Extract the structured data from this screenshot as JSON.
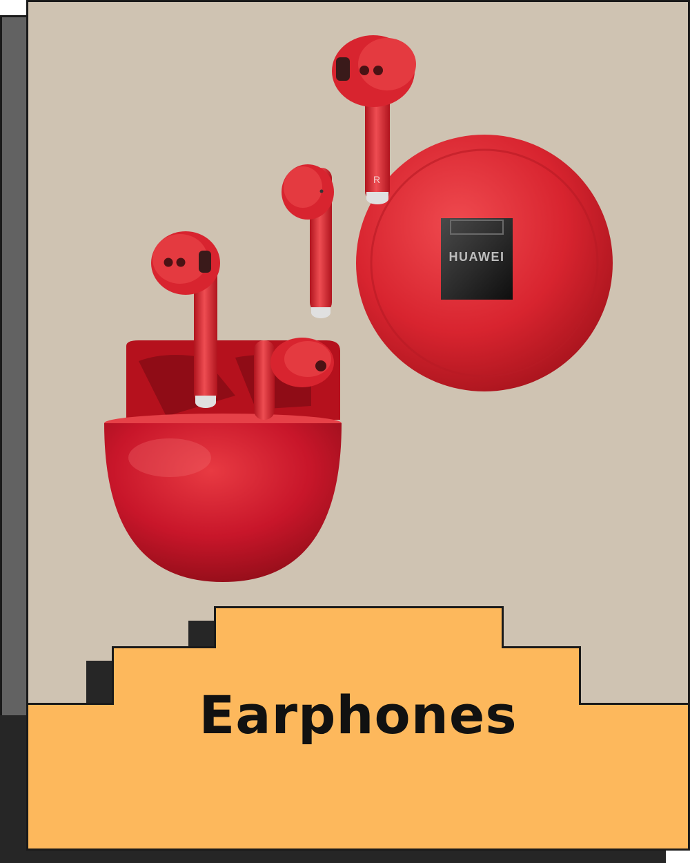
{
  "card": {
    "title": "Earphones",
    "product_brand": "HUAWEI",
    "earbud_side_mark": "R"
  },
  "colors": {
    "background_panel": "#cfc3b2",
    "accent_yellow": "#fdb85c",
    "product_red": "#d8242f",
    "border": "#1a1a1a"
  },
  "icons": {
    "product_image": "red-wireless-earbuds-with-charging-case"
  }
}
